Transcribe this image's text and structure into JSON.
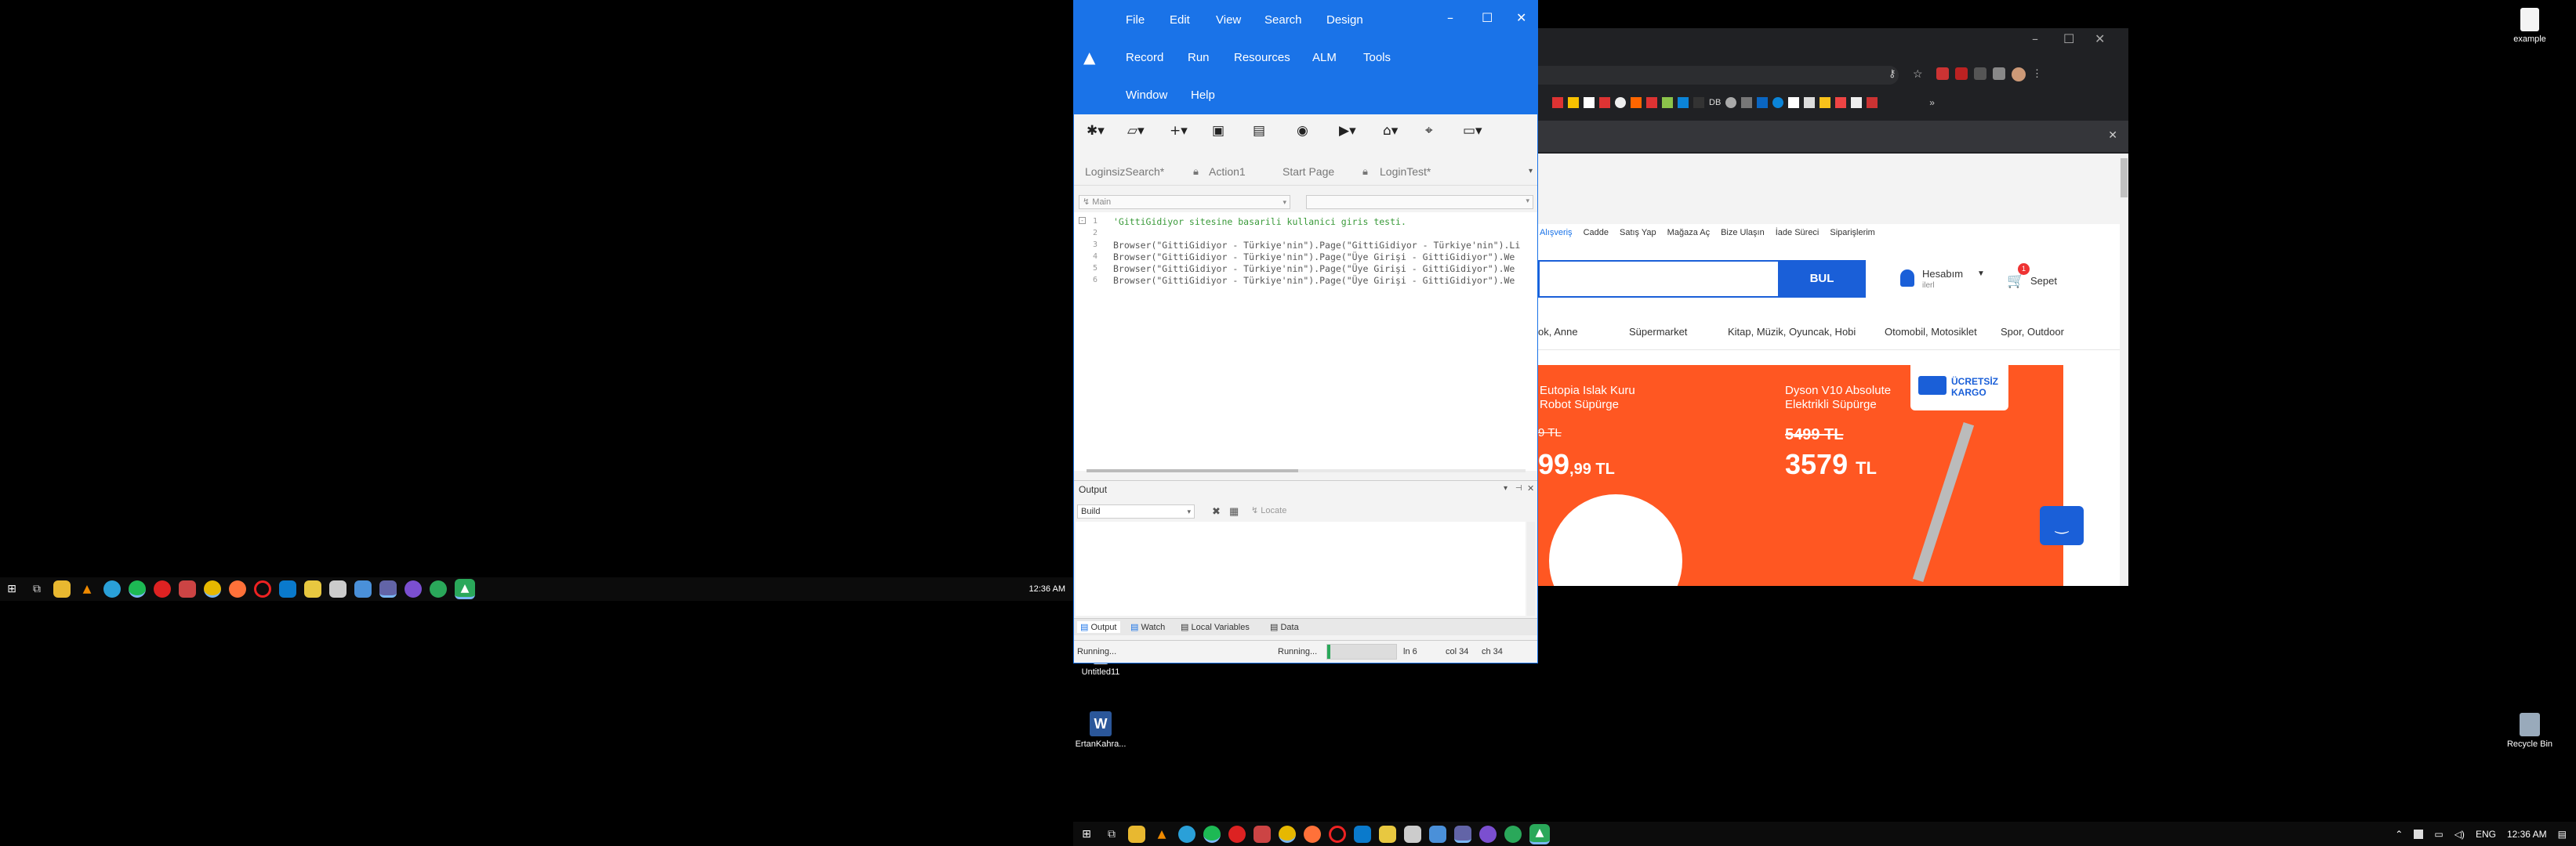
{
  "desktop_right": {
    "icons": [
      {
        "label": "example"
      },
      {
        "label": "Recycle Bin"
      }
    ]
  },
  "desktop_left": {
    "taskbar_clock": "12:36 AM"
  },
  "desktop_bottom": {
    "icons": [
      {
        "label": "Untitled11"
      },
      {
        "label": "ErtanKahra..."
      }
    ]
  },
  "taskbar_bottom": {
    "language": "ENG",
    "time": "12:36 AM"
  },
  "uft": {
    "menu_row1": [
      "File",
      "Edit",
      "View",
      "Search",
      "Design"
    ],
    "menu_row2": [
      "Record",
      "Run",
      "Resources",
      "ALM",
      "Tools"
    ],
    "menu_row3": [
      "Window",
      "Help"
    ],
    "tabs": [
      "LoginsizSearch*",
      "Action1",
      "Start Page",
      "LoginTest*"
    ],
    "scope_dropdown": "Main",
    "code_lines": [
      "'GittiGidiyor sitesine basarili kullanici giris testi.",
      "",
      "Browser(\"GittiGidiyor - Türkiye'nin\").Page(\"GittiGidiyor - Türkiye'nin\").Li",
      "Browser(\"GittiGidiyor - Türkiye'nin\").Page(\"Üye Girişi - GittiGidiyor\").We",
      "Browser(\"GittiGidiyor - Türkiye'nin\").Page(\"Üye Girişi - GittiGidiyor\").We",
      "Browser(\"GittiGidiyor - Türkiye'nin\").Page(\"Üye Girişi - GittiGidiyor\").We"
    ],
    "line_numbers": [
      "1",
      "2",
      "3",
      "4",
      "5",
      "6"
    ],
    "output_title": "Output",
    "output_filter": "Build",
    "locate_label": "Locate",
    "bottom_tabs": [
      "Output",
      "Watch",
      "Local Variables",
      "Data"
    ],
    "status_left": "Running...",
    "status_mid": "Running...",
    "status_ln": "ln 6",
    "status_col": "col 34",
    "status_ch": "ch 34"
  },
  "browser": {
    "nav_links": [
      "Alışveriş",
      "Cadde",
      "Satış Yap",
      "Mağaza Aç",
      "Bize Ulaşın",
      "İade Süreci",
      "Siparişlerim"
    ],
    "search_button": "BUL",
    "account_label": "Hesabım",
    "account_sub": "ilerl",
    "cart_label": "Sepet",
    "cart_count": "1",
    "categories": [
      "ok, Anne",
      "Süpermarket",
      "Kitap, Müzik, Oyuncak, Hobi",
      "Otomobil, Motosiklet",
      "Spor, Outdoor"
    ],
    "promo1_title_line1": "Eutopia Islak Kuru",
    "promo1_title_line2": "Robot Süpürge",
    "promo1_old": "9 TL",
    "promo1_price": "99",
    "promo1_cents": ",99 TL",
    "promo2_title_line1": "Dyson V10 Absolute",
    "promo2_title_line2": "Elektrikli Süpürge",
    "promo2_old": "5499 TL",
    "promo2_price": "3579",
    "promo2_currency": "TL",
    "cargo_line1": "ÜCRETSİZ",
    "cargo_line2": "KARGO",
    "bookmark_label": "DB",
    "colors": {
      "accent": "#1a73e8",
      "promo_bg": "#ff5722",
      "search_btn": "#1a5fd8"
    }
  }
}
